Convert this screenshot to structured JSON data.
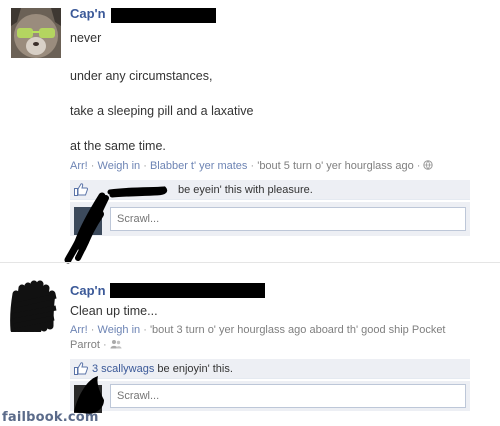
{
  "posts": [
    {
      "author": "Cap'n",
      "message_lines": [
        "never",
        "under any circumstances,",
        "take a sleeping pill and a laxative",
        "at the same time."
      ],
      "meta": {
        "action1": "Arr!",
        "action2": "Weigh in",
        "action3": "Blabber t' yer mates",
        "time": "'bout 5 turn o' yer hourglass ago",
        "privacy_icon": "globe-icon"
      },
      "likes_text": "be eyein' this with pleasure.",
      "comment_placeholder": "Scrawl..."
    },
    {
      "author": "Cap'n",
      "message_lines": [
        "Clean up time..."
      ],
      "meta": {
        "action1": "Arr!",
        "action2": "Weigh in",
        "time": "'bout 3 turn o' yer hourglass ago aboard th' good ship Pocket",
        "time_cont": "Parrot",
        "privacy_icon": "friends-icon"
      },
      "likes_link": "3 scallywags",
      "likes_text": "be enjoyin' this.",
      "comment_placeholder": "Scrawl..."
    }
  ],
  "watermark": "failbook.com",
  "colors": {
    "link": "#3b5998",
    "meta_link": "#6d84b4",
    "like_bg": "#edeff4"
  }
}
